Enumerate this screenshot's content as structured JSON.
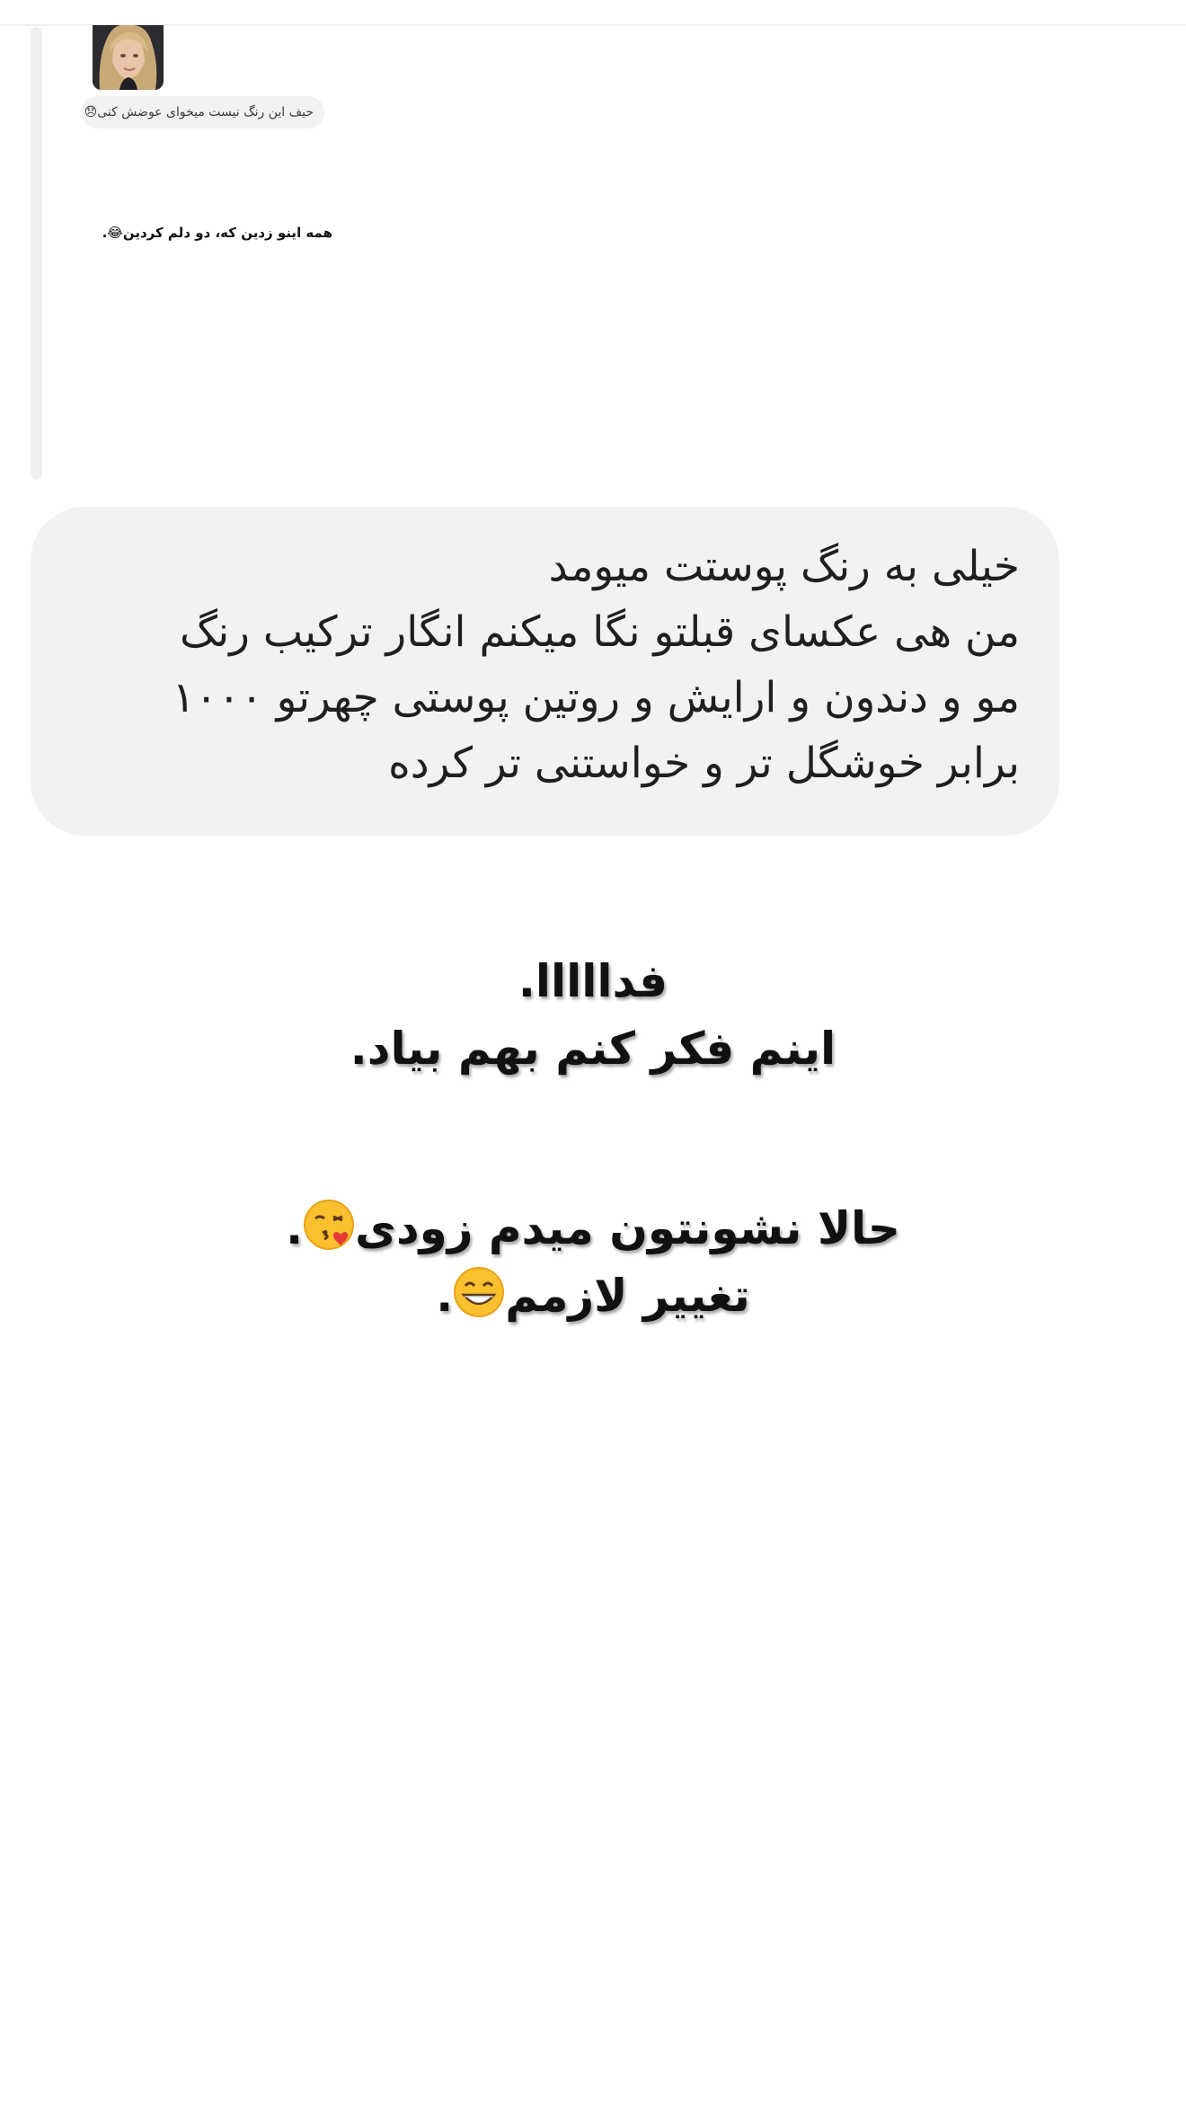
{
  "quoted_story": {
    "reply_text": "حیف این رنگ نیست میخوای عوضش کنی😞",
    "caption_text": "همه اینو زدین که، دو دلم کردین😂."
  },
  "reply_message": {
    "text": "خیلی به رنگ پوستت میومد\nمن هی عکسای قبلتو نگا میکنم انگار ترکیب رنگ\nمو و دندون و ارایش و روتین پوستی چهرتو ۱۰۰۰\nبرابر خوشگل تر و خواستنی تر کرده"
  },
  "story_text": {
    "line1": "فدااااا.",
    "line2": "اینم فکر کنم بهم بیاد.",
    "line3_text": "حالا نشونتون میدم زودی",
    "line3_emoji": "kissing-face-emoji",
    "line3_end": ".",
    "line4_text": "تغییر لازمم",
    "line4_emoji": "grinning-face-emoji",
    "line4_end": "."
  },
  "colors": {
    "bubble_background": "#f1f2f4",
    "quote_bar": "#eff0f2",
    "text": "#1f1f1f"
  }
}
